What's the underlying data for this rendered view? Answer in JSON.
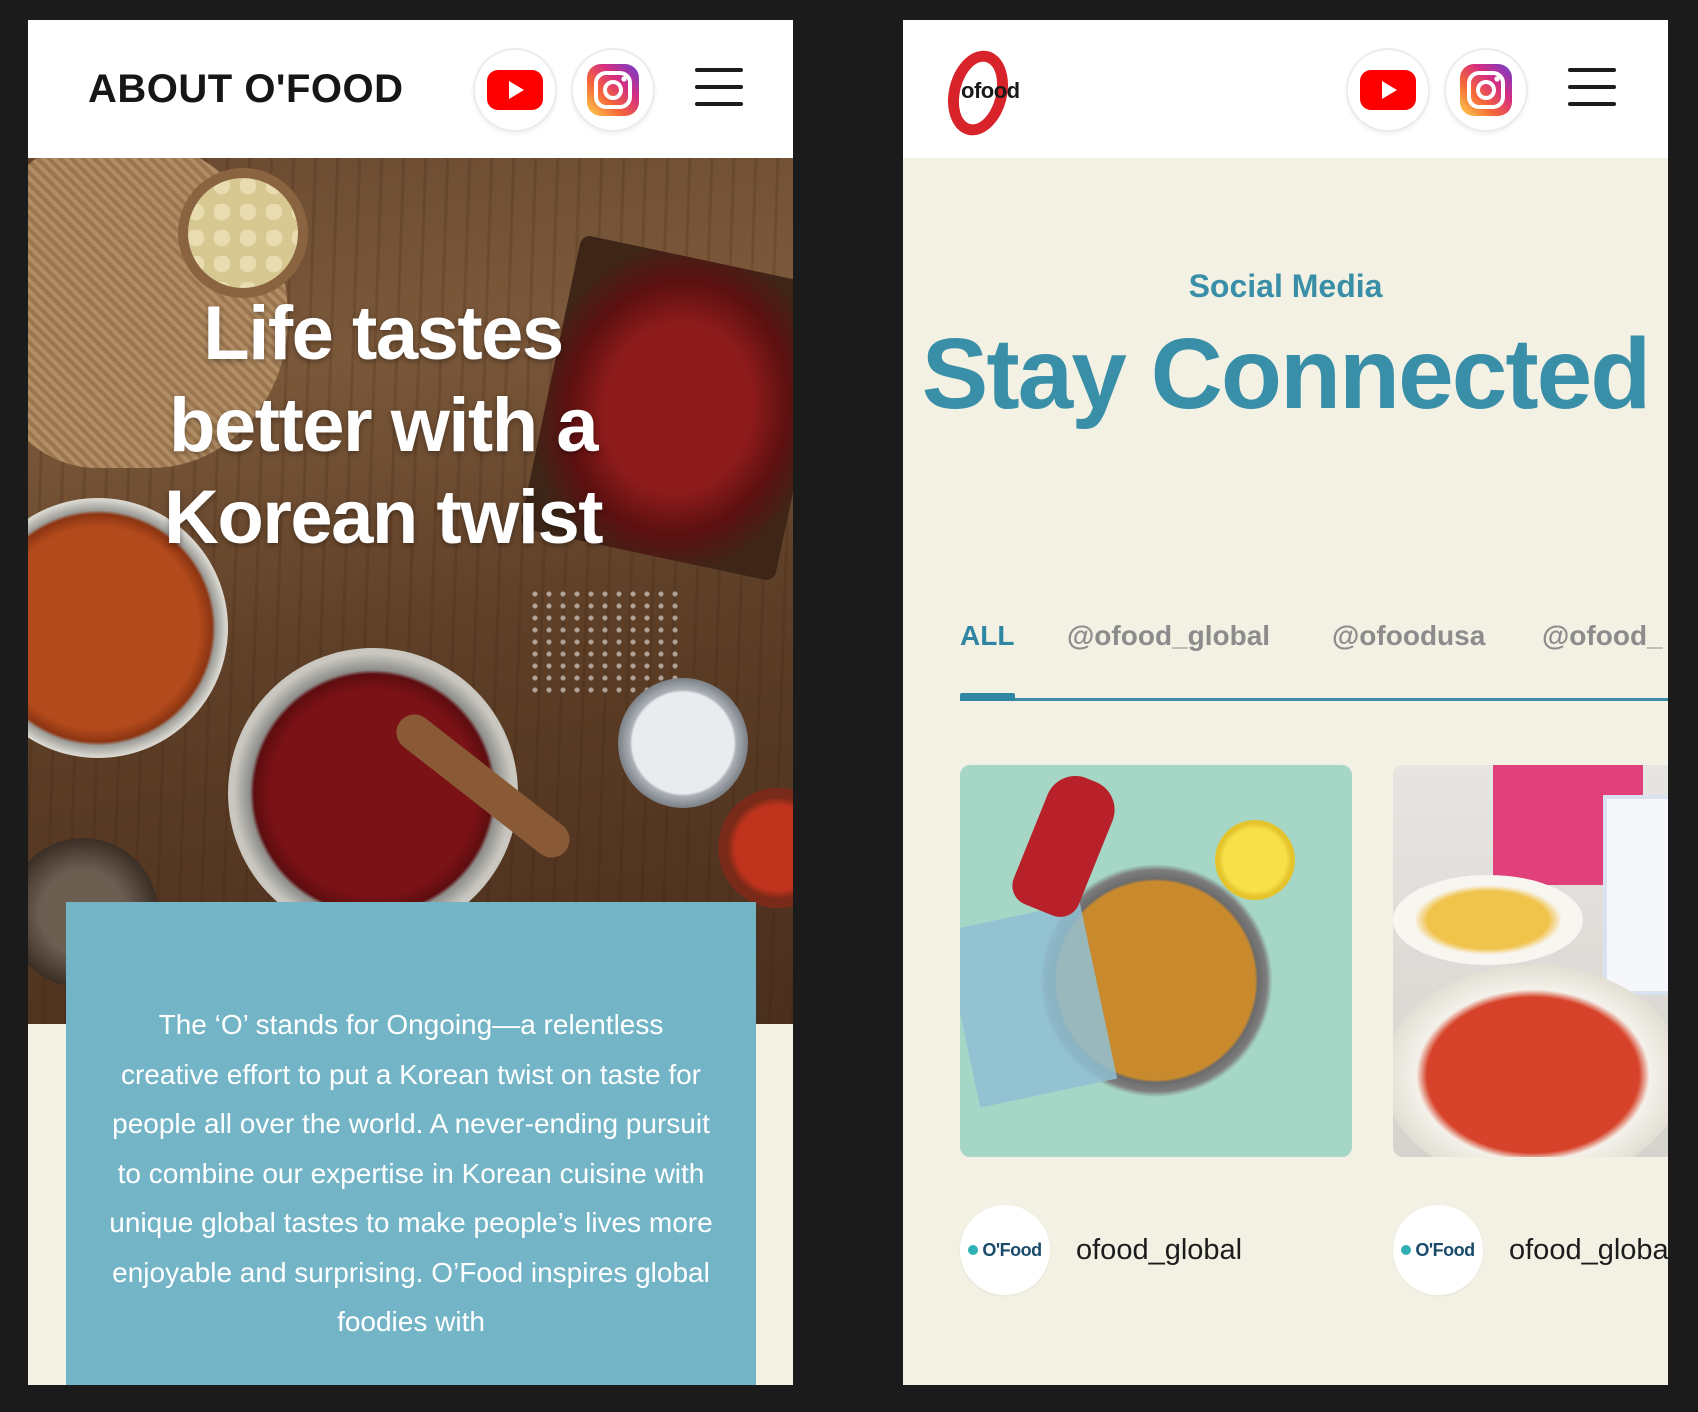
{
  "left_screen": {
    "header": {
      "title": "ABOUT O'FOOD"
    },
    "social": {
      "youtube_icon": "youtube-icon",
      "instagram_icon": "instagram-icon",
      "menu_icon": "hamburger-menu-icon"
    },
    "hero": {
      "headline": "Life tastes better with a Korean twist"
    },
    "about_text": "The ‘O’ stands for Ongoing—a relentless creative effort to put a Korean twist on taste for people all over the world. A never-ending pursuit to combine our expertise in Korean cuisine with unique global tastes to make people’s lives more enjoyable and surprising. O’Food inspires global foodies with"
  },
  "right_screen": {
    "header": {
      "logo_text": "ofood"
    },
    "section": {
      "label": "Social Media",
      "title": "Stay Connected"
    },
    "tabs": [
      {
        "label": "ALL",
        "active": true
      },
      {
        "label": "@ofood_global",
        "active": false
      },
      {
        "label": "@ofoodusa",
        "active": false
      },
      {
        "label": "@ofood_",
        "active": false
      }
    ],
    "posts": [
      {
        "account": "ofood_global",
        "avatar_text": "O'Food"
      },
      {
        "account": "ofood_globa",
        "avatar_text": "O'Food"
      }
    ]
  },
  "colors": {
    "accent_teal": "#3a8fa8",
    "card_blue": "#73b5c7",
    "background_cream": "#f3f1e3",
    "youtube_red": "#ff0000",
    "logo_red": "#d8232a"
  }
}
